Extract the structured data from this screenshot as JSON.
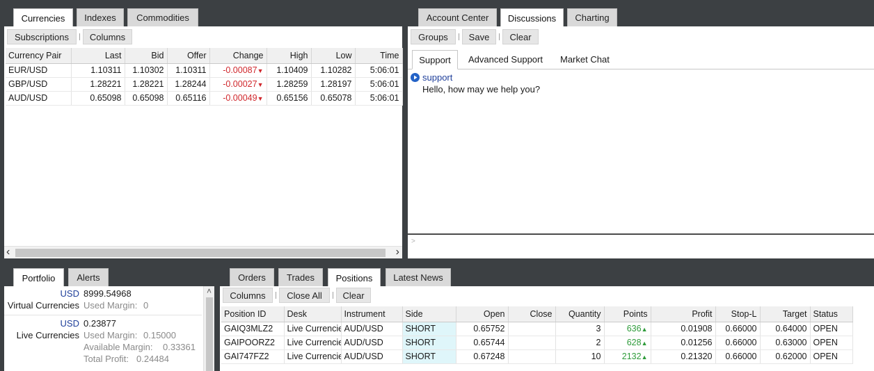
{
  "market": {
    "tabs": [
      "Currencies",
      "Indexes",
      "Commodities"
    ],
    "toolbar": [
      "Subscriptions",
      "Columns"
    ],
    "columns": [
      "Currency Pair",
      "Last",
      "Bid",
      "Offer",
      "Change",
      "High",
      "Low",
      "Time"
    ],
    "rows": [
      {
        "pair": "EUR/USD",
        "last": "1.10311",
        "bid": "1.10302",
        "offer": "1.10311",
        "change": "-0.00087",
        "high": "1.10409",
        "low": "1.10282",
        "time": "5:06:01"
      },
      {
        "pair": "GBP/USD",
        "last": "1.28221",
        "bid": "1.28221",
        "offer": "1.28244",
        "change": "-0.00027",
        "high": "1.28259",
        "low": "1.28197",
        "time": "5:06:01"
      },
      {
        "pair": "AUD/USD",
        "last": "0.65098",
        "bid": "0.65098",
        "offer": "0.65116",
        "change": "-0.00049",
        "high": "0.65156",
        "low": "0.65078",
        "time": "5:06:01"
      }
    ]
  },
  "discussion": {
    "tabs": [
      "Account Center",
      "Discussions",
      "Charting"
    ],
    "toolbar": [
      "Groups",
      "Save",
      "Clear"
    ],
    "subtabs": [
      "Support",
      "Advanced Support",
      "Market Chat"
    ],
    "message": {
      "sender": "support",
      "text": "Hello, how may we help you?"
    },
    "input_prompt": ">"
  },
  "portfolio": {
    "tabs": [
      "Portfolio",
      "Alerts"
    ],
    "accounts": [
      {
        "name": "Virtual Currencies",
        "currency": "USD",
        "balance": "8999.54968",
        "details": [
          {
            "label": "Used Margin:",
            "value": "0"
          }
        ]
      },
      {
        "name": "Live Currencies",
        "currency": "USD",
        "balance": "0.23877",
        "details": [
          {
            "label": "Used Margin:",
            "value": "0.15000"
          },
          {
            "label": "Available Margin:",
            "value": "0.33361"
          },
          {
            "label": "Total Profit:",
            "value": "0.24484"
          }
        ]
      }
    ]
  },
  "positions": {
    "tabs": [
      "Orders",
      "Trades",
      "Positions",
      "Latest News"
    ],
    "toolbar": [
      "Columns",
      "Close All",
      "Clear"
    ],
    "columns": [
      "Position ID",
      "Desk",
      "Instrument",
      "Side",
      "Open",
      "Close",
      "Quantity",
      "Points",
      "Profit",
      "Stop-L",
      "Target",
      "Status"
    ],
    "rows": [
      {
        "id": "GAIQ3MLZ2",
        "desk": "Live Currencies",
        "instrument": "AUD/USD",
        "side": "SHORT",
        "open": "0.65752",
        "close": "",
        "quantity": "3",
        "points": "636",
        "profit": "0.01908",
        "stop": "0.66000",
        "target": "0.64000",
        "status": "OPEN"
      },
      {
        "id": "GAIPOORZ2",
        "desk": "Live Currencies",
        "instrument": "AUD/USD",
        "side": "SHORT",
        "open": "0.65744",
        "close": "",
        "quantity": "2",
        "points": "628",
        "profit": "0.01256",
        "stop": "0.66000",
        "target": "0.63000",
        "status": "OPEN"
      },
      {
        "id": "GAI747FZ2",
        "desk": "Live Currencies",
        "instrument": "AUD/USD",
        "side": "SHORT",
        "open": "0.67248",
        "close": "",
        "quantity": "10",
        "points": "2132",
        "profit": "0.21320",
        "stop": "0.66000",
        "target": "0.62000",
        "status": "OPEN"
      }
    ]
  },
  "icons": {
    "down": "▼",
    "up": "▲",
    "scroll_left": "‹",
    "scroll_right": "›",
    "scroll_up": "˄",
    "chat_bullet": "play-circle-icon"
  },
  "colors": {
    "negative": "#d0282d",
    "positive": "#2e9b3a",
    "short_bg": "#dff6fa",
    "link": "#1f3f9a"
  }
}
